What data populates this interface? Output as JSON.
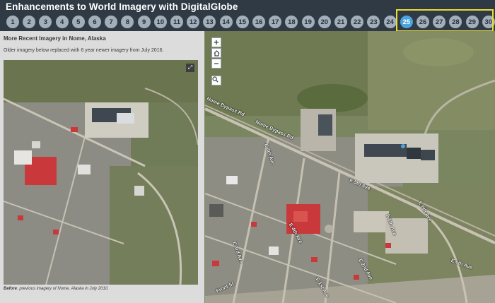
{
  "header": {
    "title": "Enhancements to World Imagery with DigitalGlobe",
    "pages": [
      "1",
      "2",
      "3",
      "4",
      "5",
      "6",
      "7",
      "8",
      "9",
      "10",
      "11",
      "12",
      "13",
      "14",
      "15",
      "16",
      "17",
      "18",
      "19",
      "20",
      "21",
      "22",
      "23",
      "24",
      "25",
      "26",
      "27",
      "28",
      "29",
      "30"
    ],
    "active_page": "25"
  },
  "map": {
    "controls": {
      "zoom_in": "+",
      "home_icon": "home-icon",
      "zoom_out": "−",
      "search_icon": "search-icon"
    },
    "labels": [
      "Nome Bypass Rd",
      "Nome Bypass Rd",
      "E 4th Ave",
      "E 5th Ave",
      "E 6th Ave",
      "E 5th Ave",
      "E 4th Ave",
      "E 6th Ave",
      "Front St",
      "E 1st Ave",
      "E 3rd Ave",
      "E 2nd Ave"
    ]
  },
  "panel": {
    "title": "More Recent Imagery in Nome, Alaska",
    "text": "Older imagery below replaced with 6 year newer imagery from July 2016.",
    "caption_lead": "Before",
    "caption_rest": ": previous imagery of Nome, Alaska in July 2010.",
    "expand_icon": "expand-icon"
  },
  "colors": {
    "header_bg": "#2f3a44",
    "number_bg": "#a2afbb",
    "active_bg": "#4aa4de",
    "highlight": "#e7dc38",
    "roof_red": "#c9383a"
  }
}
